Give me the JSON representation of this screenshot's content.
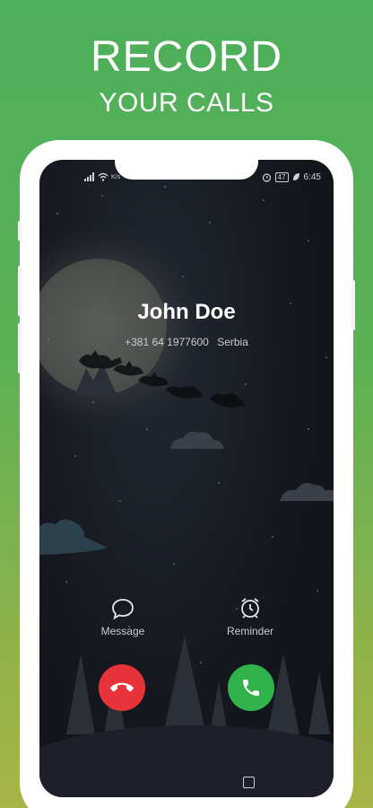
{
  "promo": {
    "headline": "RECORD",
    "subheadline": "YOUR CALLS"
  },
  "status_bar": {
    "left_text": "K/s",
    "battery": "47",
    "time": "6:45"
  },
  "caller": {
    "name": "John Doe",
    "number": "+381 64 1977600",
    "location": "Serbia"
  },
  "actions": {
    "message_label": "Message",
    "reminder_label": "Reminder"
  },
  "colors": {
    "decline": "#e8333a",
    "accept": "#2fb34a"
  },
  "icons": [
    "signal-icon",
    "wifi-icon",
    "alarm-icon",
    "leaf-icon",
    "message-icon",
    "reminder-icon",
    "decline-icon",
    "accept-icon",
    "recents-icon"
  ]
}
